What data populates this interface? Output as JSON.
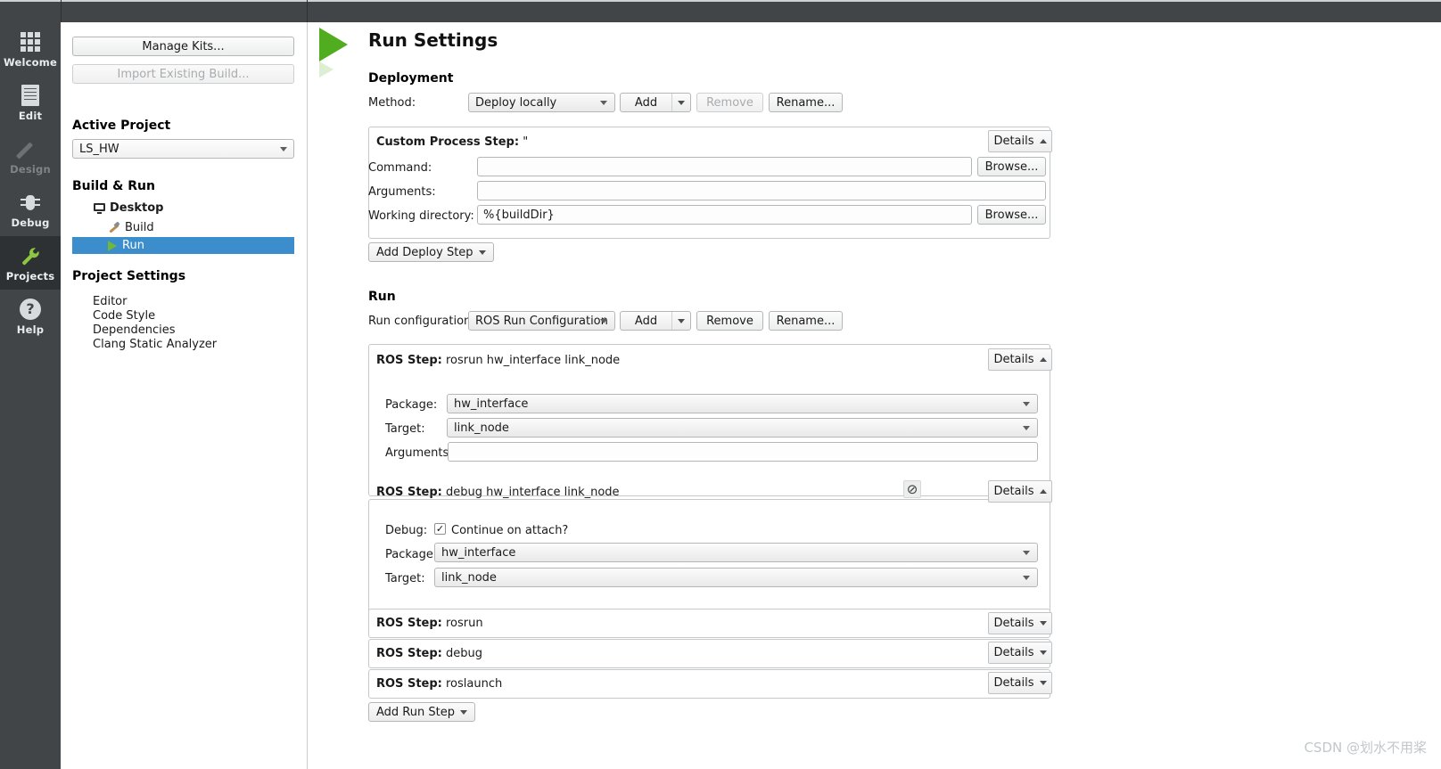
{
  "window": {
    "title": "Run Settings"
  },
  "modebar": {
    "items": [
      {
        "label": "Welcome",
        "icon": "grid-icon",
        "state": "enabled"
      },
      {
        "label": "Edit",
        "icon": "document-icon",
        "state": "enabled"
      },
      {
        "label": "Design",
        "icon": "pencil-icon",
        "state": "disabled"
      },
      {
        "label": "Debug",
        "icon": "bug-icon",
        "state": "enabled"
      },
      {
        "label": "Projects",
        "icon": "wrench-icon",
        "state": "active"
      },
      {
        "label": "Help",
        "icon": "question-icon",
        "state": "enabled"
      }
    ]
  },
  "project_panel": {
    "manage_kits_label": "Manage Kits...",
    "import_existing_label": "Import Existing Build...",
    "active_project_header": "Active Project",
    "active_project_value": "LS_HW",
    "build_run_header": "Build & Run",
    "kit_label": "Desktop",
    "build_label": "Build",
    "run_label": "Run",
    "project_settings_header": "Project Settings",
    "settings_items": [
      "Editor",
      "Code Style",
      "Dependencies",
      "Clang Static Analyzer"
    ]
  },
  "main": {
    "title": "Run Settings",
    "deployment": {
      "header": "Deployment",
      "method_label": "Method:",
      "method_value": "Deploy locally",
      "add_label": "Add",
      "remove_label": "Remove",
      "rename_label": "Rename...",
      "step": {
        "title_prefix": "Custom Process Step:",
        "title_value": "\"",
        "details_label": "Details",
        "details_state": "expanded",
        "command_label": "Command:",
        "command_value": "",
        "command_browse": "Browse...",
        "arguments_label": "Arguments:",
        "arguments_value": "",
        "working_dir_label": "Working directory:",
        "working_dir_value": "%{buildDir}",
        "working_dir_browse": "Browse..."
      },
      "add_deploy_step_label": "Add Deploy Step"
    },
    "run": {
      "header": "Run",
      "run_config_label": "Run configuration:",
      "run_config_value": "ROS Run Configuration",
      "add_label": "Add",
      "remove_label": "Remove",
      "rename_label": "Rename...",
      "steps": [
        {
          "title_prefix": "ROS Step:",
          "title_value": "rosrun hw_interface link_node",
          "details_label": "Details",
          "details_state": "expanded",
          "package_label": "Package:",
          "package_value": "hw_interface",
          "target_label": "Target:",
          "target_value": "link_node",
          "arguments_label": "Arguments:",
          "arguments_value": ""
        },
        {
          "title_prefix": "ROS Step:",
          "title_value": "debug hw_interface link_node",
          "details_label": "Details",
          "details_state": "expanded",
          "disable_icon": "ban-icon",
          "debug_label": "Debug:",
          "continue_on_attach_label": "Continue on attach?",
          "continue_on_attach_checked": "✓",
          "package_label": "Package:",
          "package_value": "hw_interface",
          "target_label": "Target:",
          "target_value": "link_node"
        },
        {
          "title_prefix": "ROS Step:",
          "title_value": "rosrun",
          "details_label": "Details",
          "details_state": "collapsed"
        },
        {
          "title_prefix": "ROS Step:",
          "title_value": "debug",
          "details_label": "Details",
          "details_state": "collapsed"
        },
        {
          "title_prefix": "ROS Step:",
          "title_value": "roslaunch",
          "details_label": "Details",
          "details_state": "collapsed"
        }
      ],
      "add_run_step_label": "Add Run Step"
    }
  },
  "watermark": {
    "text": "CSDN @划水不用桨"
  },
  "colors": {
    "chrome_dark": "#414547",
    "selection_blue": "#3b8dcb",
    "accent_green": "#51ad20"
  }
}
